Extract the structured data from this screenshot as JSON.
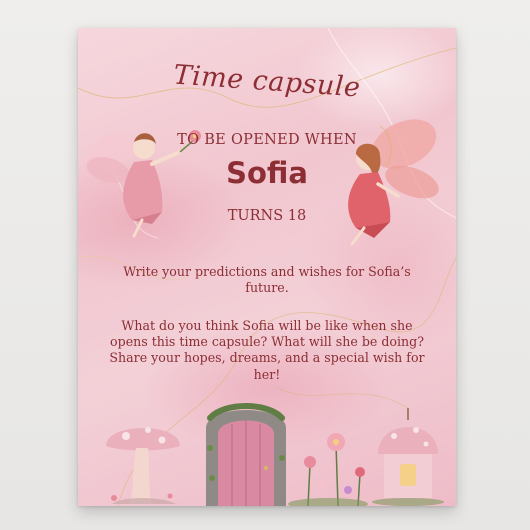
{
  "poster": {
    "title": "Time capsule",
    "opened_label": "TO BE OPENED WHEN",
    "name": "Sofia",
    "turns_label": "TURNS 18",
    "paragraph_1": "Write your predictions and wishes for Sofia’s future.",
    "paragraph_2": "What do you think Sofia will be like when she opens this time capsule? What will she be doing? Share your hopes, dreams, and a special wish for her!"
  },
  "colors": {
    "text": "#8c2e34",
    "background_pink": "#f1c6cf",
    "gold_veins": "#d9b46a"
  },
  "illustrations": [
    "fairy-left",
    "fairy-right",
    "mushroom",
    "fairy-door",
    "garden-flowers",
    "lantern-house"
  ]
}
